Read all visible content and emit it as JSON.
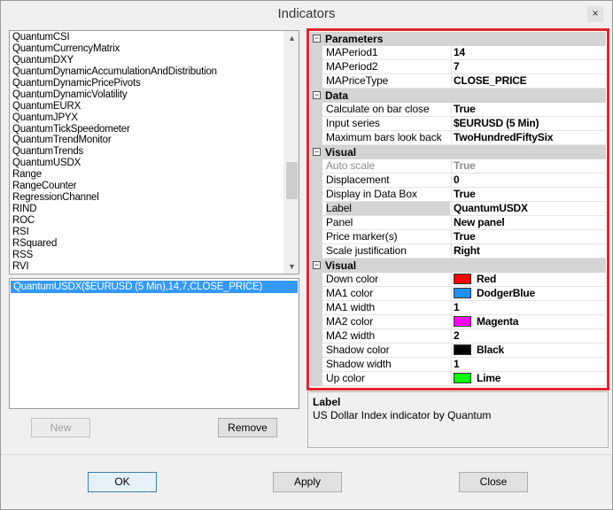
{
  "window": {
    "title": "Indicators",
    "close_glyph": "×"
  },
  "indicator_list": {
    "items": [
      "QuantumCSI",
      "QuantumCurrencyMatrix",
      "QuantumDXY",
      "QuantumDynamicAccumulationAndDistribution",
      "QuantumDynamicPricePivots",
      "QuantumDynamicVolatility",
      "QuantumEURX",
      "QuantumJPYX",
      "QuantumTickSpeedometer",
      "QuantumTrendMonitor",
      "QuantumTrends",
      "QuantumUSDX",
      "Range",
      "RangeCounter",
      "RegressionChannel",
      "RIND",
      "ROC",
      "RSI",
      "RSquared",
      "RSS",
      "RVI"
    ],
    "scroll_up": "▲",
    "scroll_down": "▼"
  },
  "configured_list": {
    "selected": "QuantumUSDX($EURUSD (5 Min),14,7,CLOSE_PRICE)"
  },
  "buttons": {
    "new": "New",
    "remove": "Remove",
    "ok": "OK",
    "apply": "Apply",
    "close": "Close"
  },
  "grid": {
    "toggle_glyph": "⊟",
    "categories": [
      {
        "label": "Parameters",
        "props": [
          {
            "name": "MAPeriod1",
            "value": "14"
          },
          {
            "name": "MAPeriod2",
            "value": "7"
          },
          {
            "name": "MAPriceType",
            "value": "CLOSE_PRICE"
          }
        ]
      },
      {
        "label": "Data",
        "props": [
          {
            "name": "Calculate on bar close",
            "value": "True"
          },
          {
            "name": "Input series",
            "value": "$EURUSD (5 Min)"
          },
          {
            "name": "Maximum bars look back",
            "value": "TwoHundredFiftySix"
          }
        ]
      },
      {
        "label": "Visual",
        "props": [
          {
            "name": "Auto scale",
            "value": "True",
            "disabled": true
          },
          {
            "name": "Displacement",
            "value": "0"
          },
          {
            "name": "Display in Data Box",
            "value": "True"
          },
          {
            "name": "Label",
            "value": "QuantumUSDX",
            "selected": true
          },
          {
            "name": "Panel",
            "value": "New panel"
          },
          {
            "name": "Price marker(s)",
            "value": "True"
          },
          {
            "name": "Scale justification",
            "value": "Right"
          }
        ]
      },
      {
        "label": "Visual",
        "props": [
          {
            "name": "Down color",
            "value": "Red",
            "color": "#ff0000"
          },
          {
            "name": "MA1 color",
            "value": "DodgerBlue",
            "color": "#1e90ff"
          },
          {
            "name": "MA1 width",
            "value": "1"
          },
          {
            "name": "MA2 color",
            "value": "Magenta",
            "color": "#ff00ff"
          },
          {
            "name": "MA2 width",
            "value": "2"
          },
          {
            "name": "Shadow color",
            "value": "Black",
            "color": "#000000"
          },
          {
            "name": "Shadow width",
            "value": "1"
          },
          {
            "name": "Up color",
            "value": "Lime",
            "color": "#00ff00"
          }
        ]
      }
    ]
  },
  "description": {
    "title": "Label",
    "text": "US Dollar Index indicator by Quantum"
  },
  "colors": {
    "highlight_border": "#e3262b",
    "selection": "#3399ff"
  }
}
